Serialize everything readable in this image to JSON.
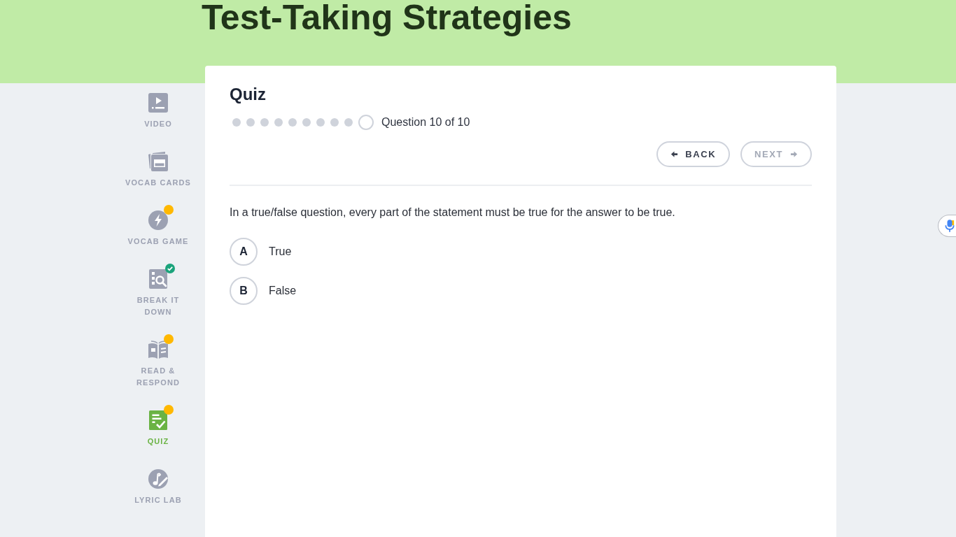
{
  "header": {
    "title": "Test-Taking Strategies"
  },
  "sidebar": {
    "items": [
      {
        "kind": "video",
        "label": "VIDEO",
        "selected": false
      },
      {
        "kind": "cards",
        "label": "VOCAB CARDS",
        "selected": false
      },
      {
        "kind": "game",
        "label": "VOCAB GAME",
        "selected": false,
        "notification": true
      },
      {
        "kind": "breakdown",
        "label": "BREAK IT DOWN",
        "selected": false,
        "completed": true
      },
      {
        "kind": "read",
        "label": "READ & RESPOND",
        "selected": false,
        "notification": true
      },
      {
        "kind": "quiz",
        "label": "QUIZ",
        "selected": true,
        "notification": true
      },
      {
        "kind": "lyric",
        "label": "LYRIC LAB",
        "selected": false
      }
    ]
  },
  "quiz": {
    "title": "Quiz",
    "steps": [
      {
        "selected": false
      },
      {
        "selected": false
      },
      {
        "selected": false
      },
      {
        "selected": false
      },
      {
        "selected": false
      },
      {
        "selected": false
      },
      {
        "selected": false
      },
      {
        "selected": false
      },
      {
        "selected": false
      },
      {
        "selected": true
      }
    ],
    "progress_text": "Question 10 of 10",
    "back": {
      "label": "BACK",
      "disabled": false
    },
    "next": {
      "label": "NEXT",
      "disabled": true
    },
    "question": "In a true/false question, every part of the statement must be true for the answer to be true.",
    "options": [
      {
        "letter": "A",
        "text": "True",
        "selected": false
      },
      {
        "letter": "B",
        "text": "False",
        "selected": false
      }
    ]
  }
}
